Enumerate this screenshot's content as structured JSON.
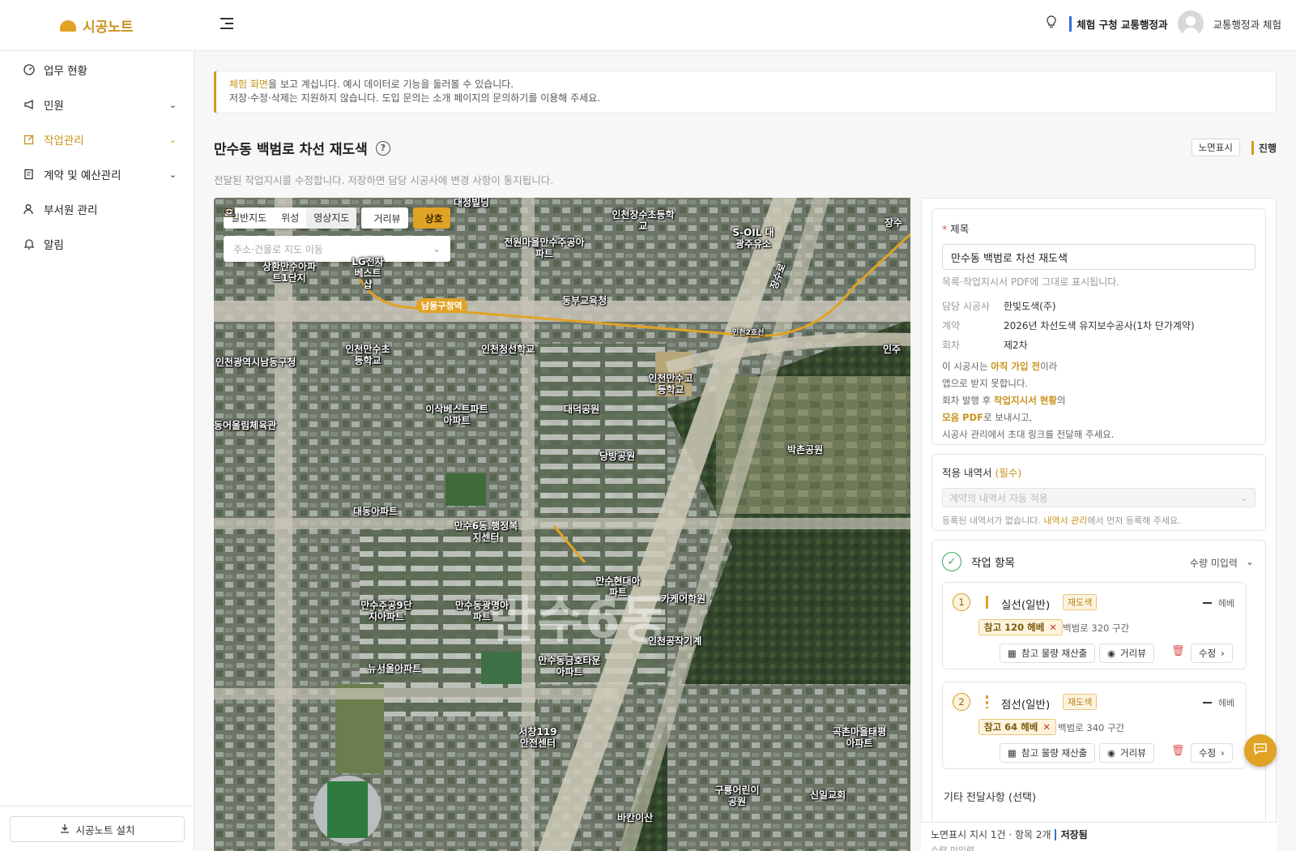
{
  "header": {
    "logo_text": "시공노트",
    "org_name": "체험 구청 교통행정과",
    "user_name": "교통행정과 체험"
  },
  "sidebar": {
    "items": [
      {
        "label": "업무 현황",
        "icon": "dashboard-icon"
      },
      {
        "label": "민원",
        "icon": "megaphone-icon",
        "expandable": true
      },
      {
        "label": "작업관리",
        "icon": "edit-icon",
        "expandable": true,
        "active": true
      },
      {
        "label": "계약 및 예산관리",
        "icon": "contract-icon",
        "expandable": true
      },
      {
        "label": "부서원 관리",
        "icon": "users-icon"
      },
      {
        "label": "알림",
        "icon": "bell-icon"
      }
    ],
    "install_label": "시공노트 설치"
  },
  "notice": {
    "highlight": "체험 화면",
    "line1_rest": "을 보고 계십니다. 예시 데이터로 기능을 둘러볼 수 있습니다.",
    "line2": "저장·수정·삭제는 지원하지 않습니다. 도입 문의는 소개 페이지의 문의하기를 이용해 주세요."
  },
  "page": {
    "title": "만수동 백범로 차선 재도색",
    "chip": "노면표시",
    "status": "진행",
    "description": "전달된 작업지시를 수정합니다. 저장하면 담당 시공사에 변경 사항이 통지됩니다."
  },
  "map": {
    "view_tabs": [
      "일반지도",
      "위성",
      "영상지도"
    ],
    "active_tab": "영상지도",
    "distance_button": "거리뷰",
    "mutual_button": "상호",
    "search_placeholder": "주소·건물로 지도 이동",
    "watermark": "만수6동",
    "station_label": "남동구청역",
    "line_label": "인천2호선",
    "pois": [
      "대정빌딩",
      "인천장수초등학교",
      "S-OIL 대광주유소",
      "전원마을만수주공아파트",
      "상환만수아파트1단지",
      "LG전자 베스트샵",
      "동부교육청",
      "인천만수초등학교",
      "인천청선학교",
      "인천광역시남동구청",
      "인천만수고등학교",
      "이삭베스트파트아파트",
      "대덕공원",
      "동어울림체육관",
      "당방공원",
      "박촌공원",
      "대동아파트",
      "만수6동 행정복지센터",
      "만수현대아파트",
      "만수주공9단지아파트",
      "만수동광명아파트",
      "카케어학원",
      "인천공작기계",
      "뉴서울아파트",
      "만수동금호타운아파트",
      "서창119안전센터",
      "곡촌마을태평아파트",
      "구룡어린이공원",
      "신일교회",
      "바칸이산",
      "장수",
      "인주",
      "장수로"
    ]
  },
  "form": {
    "title_label": "제목",
    "title_value": "만수동 백범로 차선 재도색",
    "title_hint": "목록·작업지시서 PDF에 그대로 표시됩니다.",
    "contractor_label": "담당 시공사",
    "contractor_value": "한빛도색(주)",
    "contract_label": "계약",
    "contract_value": "2026년 차선도색 유지보수공사(1차 단가계약)",
    "round_label": "회차",
    "round_value": "제2차",
    "note_1a": "이 시공사는 ",
    "note_1b": "아직 가입 전",
    "note_1c": "이라",
    "note_2": "앱으로 받지 못합니다.",
    "note_3a": "회차 발행 후 ",
    "note_3b": "작업지시서 현황",
    "note_3c": "의",
    "note_4a": "모음 PDF",
    "note_4b": "로 보내시고,",
    "note_5": "시공사 관리에서 초대 링크를 전달해 주세요.",
    "estimate_label": "적용 내역서",
    "estimate_required": "(필수)",
    "estimate_placeholder": "계약의 내역서 자동 적용",
    "estimate_hint_a": "등록된 내역서가 없습니다. ",
    "estimate_hint_b": "내역서 관리",
    "estimate_hint_c": "에서 먼저 등록해 주세요.",
    "work_items_label": "작업 항목",
    "work_items_status": "수량 미입력",
    "extra_label": "기타 전달사항 (선택)"
  },
  "work_items": [
    {
      "no": "1",
      "name": "실선(일반)",
      "tag": "재도색",
      "unit": "헤베",
      "ref": "참고 120 헤베",
      "ref_note": "백범로 320 구간",
      "recalc": "참고 물량 재산출",
      "view": "거리뷰",
      "edit": "수정",
      "line_color": "#e0a325",
      "line_style": "solid"
    },
    {
      "no": "2",
      "name": "점선(일반)",
      "tag": "재도색",
      "unit": "헤베",
      "ref": "참고 64 헤베",
      "ref_note": "백범로 340 구간",
      "recalc": "참고 물량 재산출",
      "view": "거리뷰",
      "edit": "수정",
      "line_color": "#e0a325",
      "line_style": "dashed"
    }
  ],
  "footer": {
    "summary": "노면표시 지시 1건 · 항목 2개",
    "saved": "저장됨",
    "sub": "수량 미입력"
  },
  "colors": {
    "accent": "#e0a325",
    "brand_text": "#c9931b",
    "link_blue": "#2f6fd6",
    "success": "#3aa55d",
    "danger": "#d9534f"
  }
}
